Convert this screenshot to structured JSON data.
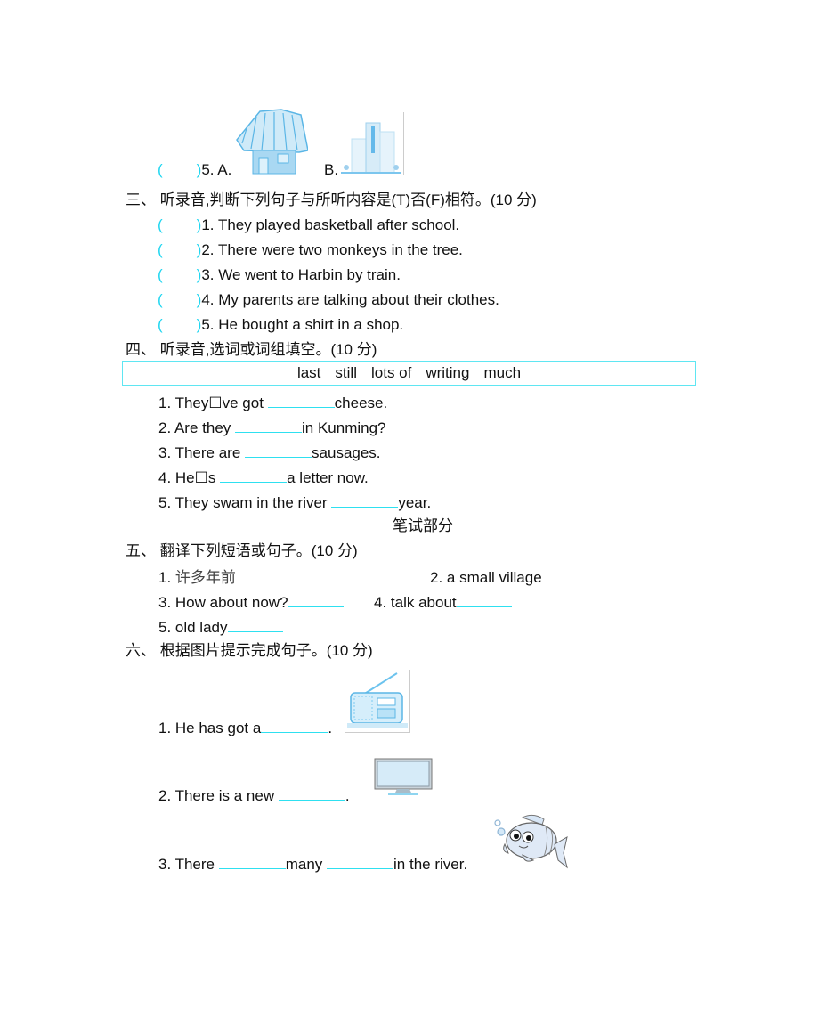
{
  "listening_q5": {
    "paren_open": "(",
    "paren_close": ")",
    "label": "5. A.",
    "option_b": "B.",
    "image_a": "thatched-house-icon",
    "image_b": "city-buildings-icon"
  },
  "section3": {
    "heading": "三、 听录音,判断下列句子与所听内容是(T)否(F)相符。(10 分)",
    "items": [
      {
        "text": "1. They played basketball after school."
      },
      {
        "text": "2. There were two monkeys in the tree."
      },
      {
        "text": "3. We went to Harbin by train."
      },
      {
        "text": "4. My parents are talking about their clothes."
      },
      {
        "text": "5. He bought a shirt in a shop."
      }
    ]
  },
  "section4": {
    "heading": "四、 听录音,选词或词组填空。(10 分)",
    "word_bank": [
      "last",
      "still",
      "lots of",
      "writing",
      "much"
    ],
    "items": [
      {
        "before": "1. They☐ve got ",
        "after": "cheese."
      },
      {
        "before": "2. Are they ",
        "after": "in Kunming?"
      },
      {
        "before": "3. There are ",
        "after": "sausages."
      },
      {
        "before": "4. He☐s ",
        "after": "a letter now."
      },
      {
        "before": "5. They swam in the river ",
        "after": "year."
      }
    ]
  },
  "written_part_title": "笔试部分",
  "section5": {
    "heading": "五、 翻译下列短语或句子。(10 分)",
    "items": [
      {
        "num": "1. ",
        "text": "许多年前 "
      },
      {
        "text": "2. a small village"
      },
      {
        "text": "3. How about now?"
      },
      {
        "text": "4. talk about"
      },
      {
        "text": "5. old lady"
      }
    ]
  },
  "section6": {
    "heading": "六、 根据图片提示完成句子。(10 分)",
    "items": [
      {
        "before": "1. He has got a",
        "after": ".",
        "image": "radio-icon"
      },
      {
        "before": "2. There is a new ",
        "after": ".",
        "image": "tv-icon"
      },
      {
        "before": "3. There ",
        "middle": "many ",
        "after": "in the river.",
        "image": "fish-icon"
      }
    ]
  }
}
